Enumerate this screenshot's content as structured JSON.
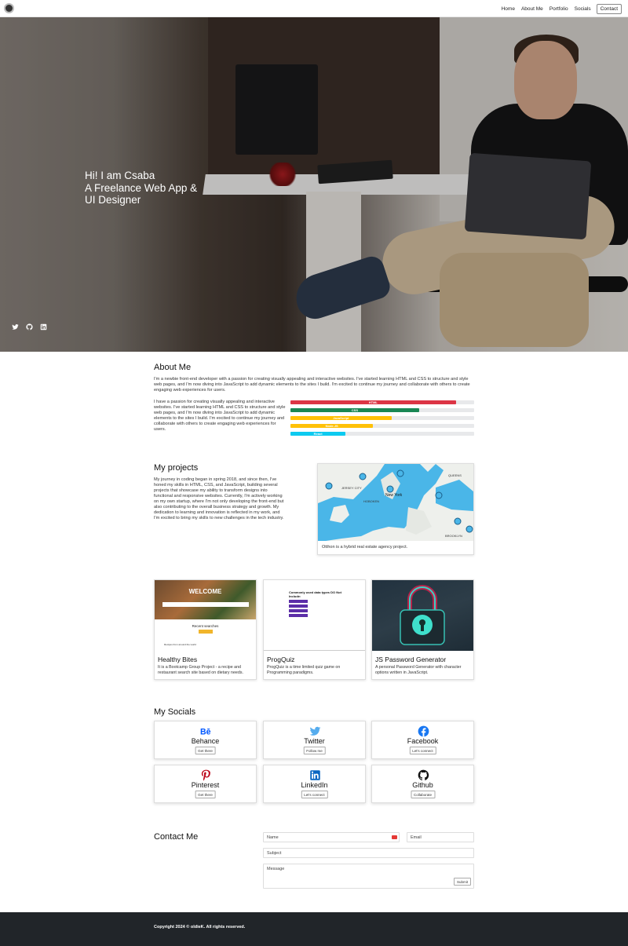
{
  "nav": {
    "logo": "gear-logo",
    "links": [
      "Home",
      "About Me",
      "Portfolio",
      "Socials"
    ],
    "contact": "Contact"
  },
  "hero": {
    "line1": "Hi! I am Csaba",
    "line2": "A Freelance Web App &",
    "line3": "UI Designer",
    "social_icons": [
      "twitter-icon",
      "github-icon",
      "linkedin-icon"
    ]
  },
  "about": {
    "title": "About Me",
    "intro": "I'm a newbie front-end developer with a passion for creating visually appealing and interactive websites. I've started learning HTML and CSS to structure and style web pages, and I'm now diving into JavaScript to add dynamic elements to the sites I build. I'm excited to continue my journey and collaborate with others to create engaging web experiences for users.",
    "body": "I have a passion for creating visually appealing and interactive websites. I've started learning HTML and CSS to structure and style web pages, and I'm now diving into JavaScript to add dynamic elements to the sites I build. I'm excited to continue my journey and collaborate with others to create engaging web experiences for users.",
    "skills": [
      {
        "label": "HTML",
        "value": 90,
        "color": "#dc3545"
      },
      {
        "label": "CSS",
        "value": 70,
        "color": "#198754"
      },
      {
        "label": "JavaScript",
        "value": 55,
        "color": "#ffc107"
      },
      {
        "label": "Node.JS",
        "value": 45,
        "color": "#ffc107"
      },
      {
        "label": "React",
        "value": 30,
        "color": "#0dcaf0"
      }
    ]
  },
  "projects": {
    "title": "My projects",
    "body": "My journey in coding began in spring 2018, and since then, I've honed my skills in HTML, CSS, and JavaScript, building several projects that showcase my ability to transform designs into functional and responsive websites. Currently, I'm actively working on my own startup, where I'm not only developing the front-end but also contributing to the overall business strategy and growth. My dedication to learning and innovation is reflected in my work, and I'm excited to bring my skills to new challenges in the tech industry.",
    "map_caption": "Otthon is a hybrid real estate agency project.",
    "map_labels": [
      "JERSEY CITY",
      "New York",
      "BROOKLYN",
      "HOBOKEN",
      "QUEENS"
    ],
    "cards": [
      {
        "title": "Healthy Bites",
        "desc": "It is a Bootcamp Group Project - a recipe and restaurant search site based on dietary needs.",
        "thumb_title": "WELCOME",
        "thumb_sub": "Recent searches",
        "thumb_sub2": "Recipes from around the world"
      },
      {
        "title": "ProgQuiz",
        "desc": "ProgQuiz is a time limited quiz game on Programming paradigms.",
        "thumb_title": "Commonly used data types DO Not Include:"
      },
      {
        "title": "JS Password Generator",
        "desc": "A personal Password Generator with character options written in JavaScript."
      }
    ]
  },
  "socials": {
    "title": "My Socials",
    "items": [
      {
        "name": "Behance",
        "btn": "Get there",
        "icon": "behance-icon",
        "color": "#0057ff"
      },
      {
        "name": "Twitter",
        "btn": "Follow me",
        "icon": "twitter-icon",
        "color": "#55acee"
      },
      {
        "name": "Facebook",
        "btn": "Let's connect",
        "icon": "facebook-icon",
        "color": "#1877f2"
      },
      {
        "name": "Pinterest",
        "btn": "Get there",
        "icon": "pinterest-icon",
        "color": "#bd081c"
      },
      {
        "name": "LinkedIn",
        "btn": "Let's connect",
        "icon": "linkedin-icon",
        "color": "#0a66c2"
      },
      {
        "name": "Github",
        "btn": "Collaborate",
        "icon": "github-icon",
        "color": "#111111"
      }
    ]
  },
  "contact": {
    "title": "Contact Me",
    "name_placeholder": "Name",
    "email_placeholder": "Email",
    "subject_placeholder": "Subject",
    "message_placeholder": "Message",
    "submit": "Submit"
  },
  "footer": {
    "text": "Copyright 2024 © oldieK. All rights reserved."
  }
}
